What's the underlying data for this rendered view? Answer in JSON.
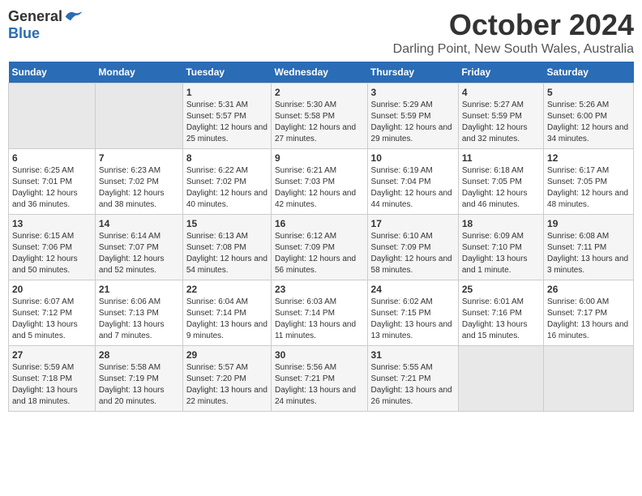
{
  "header": {
    "logo_general": "General",
    "logo_blue": "Blue",
    "title": "October 2024",
    "subtitle": "Darling Point, New South Wales, Australia"
  },
  "days_of_week": [
    "Sunday",
    "Monday",
    "Tuesday",
    "Wednesday",
    "Thursday",
    "Friday",
    "Saturday"
  ],
  "weeks": [
    {
      "days": [
        {
          "number": "",
          "empty": true
        },
        {
          "number": "",
          "empty": true
        },
        {
          "number": "1",
          "sunrise": "5:31 AM",
          "sunset": "5:57 PM",
          "daylight": "12 hours and 25 minutes."
        },
        {
          "number": "2",
          "sunrise": "5:30 AM",
          "sunset": "5:58 PM",
          "daylight": "12 hours and 27 minutes."
        },
        {
          "number": "3",
          "sunrise": "5:29 AM",
          "sunset": "5:59 PM",
          "daylight": "12 hours and 29 minutes."
        },
        {
          "number": "4",
          "sunrise": "5:27 AM",
          "sunset": "5:59 PM",
          "daylight": "12 hours and 32 minutes."
        },
        {
          "number": "5",
          "sunrise": "5:26 AM",
          "sunset": "6:00 PM",
          "daylight": "12 hours and 34 minutes."
        }
      ]
    },
    {
      "days": [
        {
          "number": "6",
          "sunrise": "6:25 AM",
          "sunset": "7:01 PM",
          "daylight": "12 hours and 36 minutes."
        },
        {
          "number": "7",
          "sunrise": "6:23 AM",
          "sunset": "7:02 PM",
          "daylight": "12 hours and 38 minutes."
        },
        {
          "number": "8",
          "sunrise": "6:22 AM",
          "sunset": "7:02 PM",
          "daylight": "12 hours and 40 minutes."
        },
        {
          "number": "9",
          "sunrise": "6:21 AM",
          "sunset": "7:03 PM",
          "daylight": "12 hours and 42 minutes."
        },
        {
          "number": "10",
          "sunrise": "6:19 AM",
          "sunset": "7:04 PM",
          "daylight": "12 hours and 44 minutes."
        },
        {
          "number": "11",
          "sunrise": "6:18 AM",
          "sunset": "7:05 PM",
          "daylight": "12 hours and 46 minutes."
        },
        {
          "number": "12",
          "sunrise": "6:17 AM",
          "sunset": "7:05 PM",
          "daylight": "12 hours and 48 minutes."
        }
      ]
    },
    {
      "days": [
        {
          "number": "13",
          "sunrise": "6:15 AM",
          "sunset": "7:06 PM",
          "daylight": "12 hours and 50 minutes."
        },
        {
          "number": "14",
          "sunrise": "6:14 AM",
          "sunset": "7:07 PM",
          "daylight": "12 hours and 52 minutes."
        },
        {
          "number": "15",
          "sunrise": "6:13 AM",
          "sunset": "7:08 PM",
          "daylight": "12 hours and 54 minutes."
        },
        {
          "number": "16",
          "sunrise": "6:12 AM",
          "sunset": "7:09 PM",
          "daylight": "12 hours and 56 minutes."
        },
        {
          "number": "17",
          "sunrise": "6:10 AM",
          "sunset": "7:09 PM",
          "daylight": "12 hours and 58 minutes."
        },
        {
          "number": "18",
          "sunrise": "6:09 AM",
          "sunset": "7:10 PM",
          "daylight": "13 hours and 1 minute."
        },
        {
          "number": "19",
          "sunrise": "6:08 AM",
          "sunset": "7:11 PM",
          "daylight": "13 hours and 3 minutes."
        }
      ]
    },
    {
      "days": [
        {
          "number": "20",
          "sunrise": "6:07 AM",
          "sunset": "7:12 PM",
          "daylight": "13 hours and 5 minutes."
        },
        {
          "number": "21",
          "sunrise": "6:06 AM",
          "sunset": "7:13 PM",
          "daylight": "13 hours and 7 minutes."
        },
        {
          "number": "22",
          "sunrise": "6:04 AM",
          "sunset": "7:14 PM",
          "daylight": "13 hours and 9 minutes."
        },
        {
          "number": "23",
          "sunrise": "6:03 AM",
          "sunset": "7:14 PM",
          "daylight": "13 hours and 11 minutes."
        },
        {
          "number": "24",
          "sunrise": "6:02 AM",
          "sunset": "7:15 PM",
          "daylight": "13 hours and 13 minutes."
        },
        {
          "number": "25",
          "sunrise": "6:01 AM",
          "sunset": "7:16 PM",
          "daylight": "13 hours and 15 minutes."
        },
        {
          "number": "26",
          "sunrise": "6:00 AM",
          "sunset": "7:17 PM",
          "daylight": "13 hours and 16 minutes."
        }
      ]
    },
    {
      "days": [
        {
          "number": "27",
          "sunrise": "5:59 AM",
          "sunset": "7:18 PM",
          "daylight": "13 hours and 18 minutes."
        },
        {
          "number": "28",
          "sunrise": "5:58 AM",
          "sunset": "7:19 PM",
          "daylight": "13 hours and 20 minutes."
        },
        {
          "number": "29",
          "sunrise": "5:57 AM",
          "sunset": "7:20 PM",
          "daylight": "13 hours and 22 minutes."
        },
        {
          "number": "30",
          "sunrise": "5:56 AM",
          "sunset": "7:21 PM",
          "daylight": "13 hours and 24 minutes."
        },
        {
          "number": "31",
          "sunrise": "5:55 AM",
          "sunset": "7:21 PM",
          "daylight": "13 hours and 26 minutes."
        },
        {
          "number": "",
          "empty": true
        },
        {
          "number": "",
          "empty": true
        }
      ]
    }
  ]
}
